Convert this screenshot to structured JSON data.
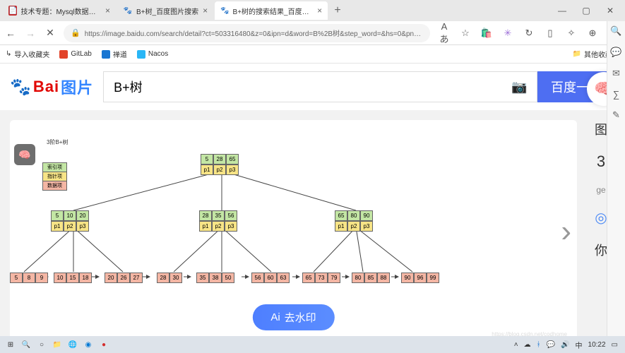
{
  "titlebar": {
    "tabs": [
      {
        "label": "技术专题：Mysql数据库（视图…",
        "fav_bg": "#c62828",
        "fav_label": "📄"
      },
      {
        "label": "B+树_百度图片搜索",
        "fav_bg": "#fff",
        "fav_label": "🐾"
      },
      {
        "label": "B+树的搜索结果_百度图片搜索",
        "fav_bg": "#fff",
        "fav_label": "🐾"
      }
    ],
    "newtab": "+",
    "min": "—",
    "max": "▢",
    "close": "✕"
  },
  "addr": {
    "back": "←",
    "fwd": "→",
    "stop": "✕",
    "url": "https://image.baidu.com/search/detail?ct=503316480&z=0&ipn=d&word=B%2B树&step_word=&hs=0&pn…",
    "readaloud": "Aあ",
    "star": "☆"
  },
  "bookmarks": {
    "import": "导入收藏夹",
    "items": [
      {
        "icon_bg": "#e24329",
        "label": "GitLab"
      },
      {
        "icon_bg": "#4caf50",
        "label": "禅道"
      },
      {
        "icon_bg": "#29b6f6",
        "label": "Nacos"
      }
    ],
    "other": "其他收藏夹"
  },
  "search": {
    "logo_text": "Bai",
    "logo_cn": "图片",
    "value": "B+树",
    "placeholder": "",
    "button": "百度一下"
  },
  "diagram": {
    "title": "3阶B+树",
    "legend": {
      "l1": "索引项",
      "l2": "指针项",
      "l3": "数据项"
    },
    "root_idx": [
      "5",
      "28",
      "65"
    ],
    "root_ptr": [
      "p1",
      "p2",
      "p3"
    ],
    "l2a_idx": [
      "5",
      "10",
      "20"
    ],
    "l2a_ptr": [
      "p1",
      "p2",
      "p3"
    ],
    "l2b_idx": [
      "28",
      "35",
      "56"
    ],
    "l2b_ptr": [
      "p1",
      "p2",
      "p3"
    ],
    "l2c_idx": [
      "65",
      "80",
      "90"
    ],
    "l2c_ptr": [
      "p1",
      "p2",
      "p3"
    ],
    "leaf1": [
      "5",
      "8",
      "9"
    ],
    "leaf2": [
      "10",
      "15",
      "18"
    ],
    "leaf3": [
      "20",
      "26",
      "27"
    ],
    "leaf4": [
      "28",
      "30"
    ],
    "leaf5": [
      "35",
      "38",
      "50"
    ],
    "leaf6": [
      "56",
      "60",
      "63"
    ],
    "leaf7": [
      "65",
      "73",
      "79"
    ],
    "leaf8": [
      "80",
      "85",
      "88"
    ],
    "leaf9": [
      "90",
      "96",
      "99"
    ]
  },
  "side": {
    "t1": "图",
    "t2": "3",
    "t3": "ge",
    "you": "你",
    "ring": "◎"
  },
  "removewm": "去水印",
  "src": "https://blog.csdn.net/codhome",
  "tray": {
    "time": "10:22",
    "arrow": "˄"
  }
}
